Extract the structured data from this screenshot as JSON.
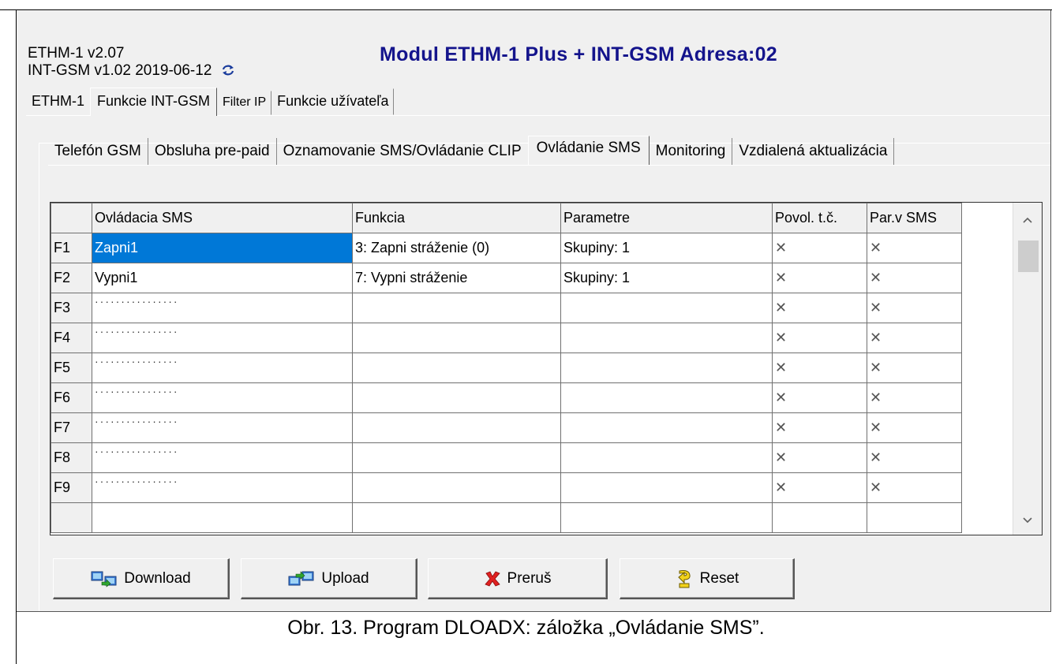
{
  "header": {
    "version_line1": "ETHM-1 v2.07",
    "version_line2": "INT-GSM v1.02 2019-06-12",
    "title": "Modul ETHM-1 Plus + INT-GSM Adresa:02",
    "title_color": "#14148c"
  },
  "tabs_main": [
    {
      "label": "ETHM-1"
    },
    {
      "label": "Funkcie INT-GSM",
      "active": true
    },
    {
      "label": "Filter IP"
    },
    {
      "label": "Funkcie užívateľa"
    }
  ],
  "tabs_sub": [
    {
      "label": "Telefón GSM"
    },
    {
      "label": "Obsluha pre-paid"
    },
    {
      "label": "Oznamovanie SMS/Ovládanie CLIP"
    },
    {
      "label": "Ovládanie SMS",
      "active": true
    },
    {
      "label": "Monitoring"
    },
    {
      "label": "Vzdialená aktualizácia"
    }
  ],
  "grid": {
    "columns": [
      "",
      "Ovládacia SMS",
      "Funkcia",
      "Parametre",
      "Povol. t.č.",
      "Par.v SMS"
    ],
    "rows": [
      {
        "id": "F1",
        "sms": "Zapni1",
        "func": "3: Zapni stráženie (0)",
        "param": "Skupiny: 1",
        "povol": "✕",
        "par": "✕"
      },
      {
        "id": "F2",
        "sms": "Vypni1",
        "func": "7: Vypni stráženie",
        "param": "Skupiny: 1",
        "povol": "✕",
        "par": "✕"
      },
      {
        "id": "F3",
        "sms": "················",
        "func": "",
        "param": "",
        "povol": "✕",
        "par": "✕"
      },
      {
        "id": "F4",
        "sms": "················",
        "func": "",
        "param": "",
        "povol": "✕",
        "par": "✕"
      },
      {
        "id": "F5",
        "sms": "················",
        "func": "",
        "param": "",
        "povol": "✕",
        "par": "✕"
      },
      {
        "id": "F6",
        "sms": "················",
        "func": "",
        "param": "",
        "povol": "✕",
        "par": "✕"
      },
      {
        "id": "F7",
        "sms": "················",
        "func": "",
        "param": "",
        "povol": "✕",
        "par": "✕"
      },
      {
        "id": "F8",
        "sms": "················",
        "func": "",
        "param": "",
        "povol": "✕",
        "par": "✕"
      },
      {
        "id": "F9",
        "sms": "················",
        "func": "",
        "param": "",
        "povol": "✕",
        "par": "✕"
      }
    ],
    "selection_color": "#0078d7"
  },
  "buttons": {
    "download": "Download",
    "upload": "Upload",
    "abort": "Preruš",
    "reset": "Reset"
  },
  "icons": {
    "refresh": "refresh-icon",
    "download": "download-icon",
    "upload": "upload-icon",
    "abort": "red-x-icon",
    "reset": "reset-icon"
  },
  "caption": "Obr. 13. Program DLOADX: záložka „Ovládanie SMS”."
}
